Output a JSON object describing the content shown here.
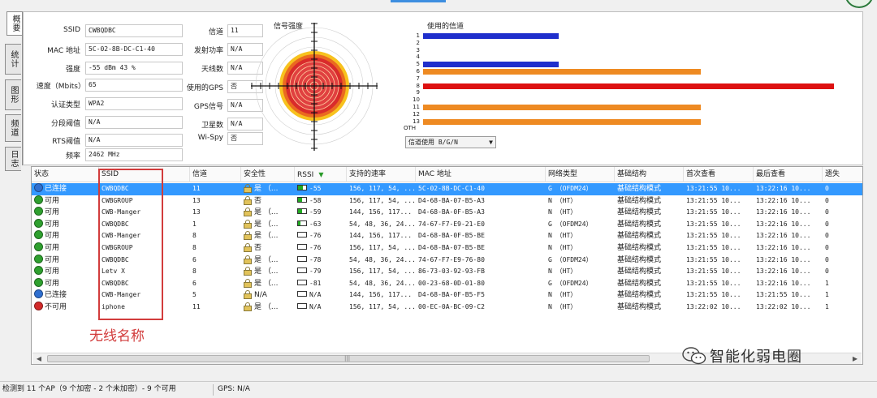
{
  "tabs": [
    {
      "label": "概要",
      "active": true
    },
    {
      "label": "统计",
      "active": false
    },
    {
      "label": "图形",
      "active": false
    },
    {
      "label": "频道",
      "active": false
    },
    {
      "label": "日志",
      "active": false
    }
  ],
  "info": {
    "left": [
      {
        "label": "SSID",
        "value": "CWBQDBC"
      },
      {
        "label": "MAC 地址",
        "value": "5C-02-8B-DC-C1-40"
      },
      {
        "label": "强度",
        "value": "-55 dBm     43 %"
      },
      {
        "label": "速度（Mbits）",
        "value": "65"
      },
      {
        "label": "认证类型",
        "value": "WPA2"
      },
      {
        "label": "分段阈值",
        "value": "N/A"
      },
      {
        "label": "RTS阈值",
        "value": "N/A"
      },
      {
        "label": "频率",
        "value": "2462 MHz"
      }
    ],
    "right": [
      {
        "label": "信道",
        "value": "11"
      },
      {
        "label": "发射功率",
        "value": "N/A"
      },
      {
        "label": "天线数",
        "value": "N/A"
      },
      {
        "label": "使用的GPS",
        "value": "否"
      },
      {
        "label": "GPS信号",
        "value": "N/A"
      },
      {
        "label": "卫星数",
        "value": "N/A"
      },
      {
        "label": "Wi-Spy",
        "value": "否"
      }
    ]
  },
  "signal_title": "信号强度",
  "channels": {
    "title": "使用的信道",
    "labels": [
      "1",
      "2",
      "3",
      "4",
      "5",
      "6",
      "7",
      "8",
      "9",
      "10",
      "11",
      "12",
      "13",
      "OTH"
    ],
    "bars": [
      {
        "channel": "1",
        "start": 0.0,
        "end": 0.33,
        "color": "#1f2fcc"
      },
      {
        "channel": "5",
        "start": 0.0,
        "end": 0.33,
        "color": "#1f2fcc"
      },
      {
        "channel": "6",
        "start": 0.0,
        "end": 0.675,
        "color": "#ee8a22"
      },
      {
        "channel": "8",
        "start": 0.0,
        "end": 1.0,
        "color": "#dd1111"
      },
      {
        "channel": "11",
        "start": 0.0,
        "end": 0.675,
        "color": "#ee8a22"
      },
      {
        "channel": "13",
        "start": 0.0,
        "end": 0.675,
        "color": "#ee8a22"
      }
    ],
    "select_value": "信道使用 B/G/N",
    "select_arrow": "▼"
  },
  "table": {
    "headers": [
      "状态",
      "SSID",
      "信道",
      "安全性",
      "RSSI",
      "支持的速率",
      "MAC 地址",
      "网络类型",
      "基础结构",
      "首次查看",
      "最后查看",
      "遗失"
    ],
    "sort_mark": "▼",
    "rows": [
      {
        "status": "已连接",
        "status_color": "#2f6fd0",
        "ssid": "CWBQDBC",
        "channel": "11",
        "lock": true,
        "security": "是 （...",
        "rssi": "-55",
        "rssi_level": 0.55,
        "rates": "156, 117, 54, ...",
        "mac": "5C-02-8B-DC-C1-40",
        "nettype": "G （OFDM24）",
        "infra": "基础结构模式",
        "first": "13:21:55 10...",
        "last": "13:22:16 10...",
        "lost": "0",
        "selected": true
      },
      {
        "status": "可用",
        "status_color": "#2fa02f",
        "ssid": "CWBGROUP",
        "channel": "13",
        "lock": false,
        "security": "否",
        "rssi": "-58",
        "rssi_level": 0.45,
        "rates": "156, 117, 54, ...",
        "mac": "D4-68-BA-07-B5-A3",
        "nettype": "N （HT）",
        "infra": "基础结构模式",
        "first": "13:21:55 10...",
        "last": "13:22:16 10...",
        "lost": "0",
        "selected": false
      },
      {
        "status": "可用",
        "status_color": "#2fa02f",
        "ssid": "CWB-Manger",
        "channel": "13",
        "lock": true,
        "security": "是 （...",
        "rssi": "-59",
        "rssi_level": 0.45,
        "rates": "144, 156, 117...",
        "mac": "D4-68-BA-0F-B5-A3",
        "nettype": "N （HT）",
        "infra": "基础结构模式",
        "first": "13:21:55 10...",
        "last": "13:22:16 10...",
        "lost": "0",
        "selected": false
      },
      {
        "status": "可用",
        "status_color": "#2fa02f",
        "ssid": "CWBQDBC",
        "channel": "1",
        "lock": true,
        "security": "是 （...",
        "rssi": "-63",
        "rssi_level": 0.3,
        "rates": "54, 48, 36, 24...",
        "mac": "74-67-F7-E9-21-E0",
        "nettype": "G （OFDM24）",
        "infra": "基础结构模式",
        "first": "13:21:55 10...",
        "last": "13:22:16 10...",
        "lost": "0",
        "selected": false
      },
      {
        "status": "可用",
        "status_color": "#2fa02f",
        "ssid": "CWB-Manger",
        "channel": "8",
        "lock": true,
        "security": "是 （...",
        "rssi": "-76",
        "rssi_level": 0.0,
        "rates": "144, 156, 117...",
        "mac": "D4-68-BA-0F-B5-BE",
        "nettype": "N （HT）",
        "infra": "基础结构模式",
        "first": "13:21:55 10...",
        "last": "13:22:16 10...",
        "lost": "0",
        "selected": false
      },
      {
        "status": "可用",
        "status_color": "#2fa02f",
        "ssid": "CWBGROUP",
        "channel": "8",
        "lock": false,
        "security": "否",
        "rssi": "-76",
        "rssi_level": 0.0,
        "rates": "156, 117, 54, ...",
        "mac": "D4-68-BA-07-B5-BE",
        "nettype": "N （HT）",
        "infra": "基础结构模式",
        "first": "13:21:55 10...",
        "last": "13:22:16 10...",
        "lost": "0",
        "selected": false
      },
      {
        "status": "可用",
        "status_color": "#2fa02f",
        "ssid": "CWBQDBC",
        "channel": "6",
        "lock": true,
        "security": "是 （...",
        "rssi": "-78",
        "rssi_level": 0.0,
        "rates": "54, 48, 36, 24...",
        "mac": "74-67-F7-E9-76-80",
        "nettype": "G （OFDM24）",
        "infra": "基础结构模式",
        "first": "13:21:55 10...",
        "last": "13:22:16 10...",
        "lost": "0",
        "selected": false
      },
      {
        "status": "可用",
        "status_color": "#2fa02f",
        "ssid": "Letv X",
        "channel": "8",
        "lock": true,
        "security": "是 （...",
        "rssi": "-79",
        "rssi_level": 0.0,
        "rates": "156, 117, 54, ...",
        "mac": "86-73-03-92-93-FB",
        "nettype": "N （HT）",
        "infra": "基础结构模式",
        "first": "13:21:55 10...",
        "last": "13:22:16 10...",
        "lost": "0",
        "selected": false
      },
      {
        "status": "可用",
        "status_color": "#2fa02f",
        "ssid": "CWBQDBC",
        "channel": "6",
        "lock": true,
        "security": "是 （...",
        "rssi": "-81",
        "rssi_level": 0.0,
        "rates": "54, 48, 36, 24...",
        "mac": "00-23-68-0D-01-80",
        "nettype": "G （OFDM24）",
        "infra": "基础结构模式",
        "first": "13:21:55 10...",
        "last": "13:22:16 10...",
        "lost": "1",
        "selected": false
      },
      {
        "status": "已连接",
        "status_color": "#2f6fd0",
        "ssid": "CWB-Manger",
        "channel": "5",
        "lock": true,
        "security": "N/A",
        "rssi": "N/A",
        "rssi_level": 0.0,
        "rates": "144, 156, 117...",
        "mac": "D4-68-BA-0F-B5-F5",
        "nettype": "N （HT）",
        "infra": "基础结构模式",
        "first": "13:21:55 10...",
        "last": "13:21:55 10...",
        "lost": "1",
        "selected": false
      },
      {
        "status": "不可用",
        "status_color": "#d22a2a",
        "ssid": "iphone",
        "channel": "11",
        "lock": true,
        "security": "是 （...",
        "rssi": "N/A",
        "rssi_level": 0.0,
        "rates": "156, 117, 54, ...",
        "mac": "00-EC-0A-BC-09-C2",
        "nettype": "N （HT）",
        "infra": "基础结构模式",
        "first": "13:22:02 10...",
        "last": "13:22:02 10...",
        "lost": "1",
        "selected": false
      }
    ]
  },
  "annotation": "无线名称",
  "scroll_grip": "|||",
  "scroll_left": "◀",
  "scroll_right": "▶",
  "watermark": "智能化弱电圈",
  "status": {
    "summary": "检测到 11 个AP（9 个加密 - 2 个未加密）- 9 个可用",
    "gps": "GPS: N/A"
  }
}
